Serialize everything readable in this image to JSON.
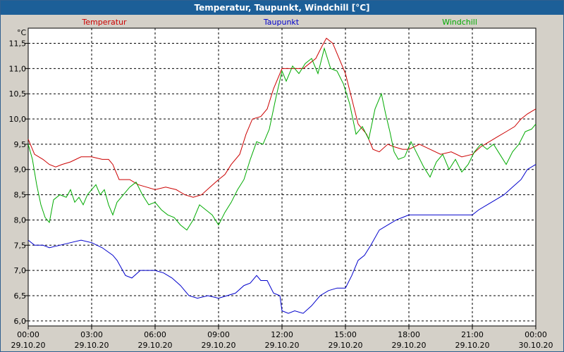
{
  "window": {
    "title": "Temperatur, Taupunkt, Windchill [°C]"
  },
  "chart_data": {
    "type": "line",
    "title": "Temperatur, Taupunkt, Windchill [°C]",
    "ylabel": "°C",
    "xlabel": "",
    "ylim": [
      5.9,
      11.8
    ],
    "xlim": [
      0,
      24
    ],
    "grid": true,
    "legend": "top",
    "y_ticks": [
      "6,0",
      "6,5",
      "7,0",
      "7,5",
      "8,0",
      "8,5",
      "9,0",
      "9,5",
      "10,0",
      "10,5",
      "11,0",
      "11,5"
    ],
    "x_ticks": [
      {
        "time": "00:00",
        "date": "29.10.20"
      },
      {
        "time": "03:00",
        "date": "29.10.20"
      },
      {
        "time": "06:00",
        "date": "29.10.20"
      },
      {
        "time": "09:00",
        "date": "29.10.20"
      },
      {
        "time": "12:00",
        "date": "29.10.20"
      },
      {
        "time": "15:00",
        "date": "29.10.20"
      },
      {
        "time": "18:00",
        "date": "29.10.20"
      },
      {
        "time": "21:00",
        "date": "29.10.20"
      },
      {
        "time": "00:00",
        "date": "30.10.20"
      }
    ],
    "series": [
      {
        "name": "Temperatur",
        "color": "#cc0000",
        "points": [
          [
            0,
            9.6
          ],
          [
            0.3,
            9.3
          ],
          [
            0.7,
            9.2
          ],
          [
            1,
            9.1
          ],
          [
            1.3,
            9.05
          ],
          [
            1.6,
            9.1
          ],
          [
            2,
            9.15
          ],
          [
            2.5,
            9.25
          ],
          [
            3,
            9.25
          ],
          [
            3.5,
            9.2
          ],
          [
            3.8,
            9.2
          ],
          [
            4,
            9.1
          ],
          [
            4.3,
            8.8
          ],
          [
            4.8,
            8.8
          ],
          [
            5.2,
            8.7
          ],
          [
            5.6,
            8.65
          ],
          [
            6,
            8.6
          ],
          [
            6.5,
            8.65
          ],
          [
            7,
            8.6
          ],
          [
            7.4,
            8.5
          ],
          [
            7.8,
            8.45
          ],
          [
            8.2,
            8.5
          ],
          [
            8.6,
            8.65
          ],
          [
            9,
            8.8
          ],
          [
            9.3,
            8.9
          ],
          [
            9.6,
            9.1
          ],
          [
            10,
            9.3
          ],
          [
            10.3,
            9.7
          ],
          [
            10.6,
            10.0
          ],
          [
            11,
            10.05
          ],
          [
            11.3,
            10.2
          ],
          [
            11.6,
            10.6
          ],
          [
            12,
            11.0
          ],
          [
            12.5,
            11.0
          ],
          [
            13,
            11.0
          ],
          [
            13.3,
            11.1
          ],
          [
            13.6,
            11.2
          ],
          [
            13.9,
            11.45
          ],
          [
            14.1,
            11.6
          ],
          [
            14.4,
            11.5
          ],
          [
            14.8,
            11.1
          ],
          [
            15,
            10.9
          ],
          [
            15.3,
            10.4
          ],
          [
            15.6,
            9.9
          ],
          [
            16,
            9.7
          ],
          [
            16.3,
            9.4
          ],
          [
            16.6,
            9.35
          ],
          [
            17,
            9.5
          ],
          [
            17.3,
            9.45
          ],
          [
            17.7,
            9.4
          ],
          [
            18,
            9.4
          ],
          [
            18.5,
            9.5
          ],
          [
            19,
            9.4
          ],
          [
            19.5,
            9.3
          ],
          [
            20,
            9.35
          ],
          [
            20.5,
            9.25
          ],
          [
            21,
            9.3
          ],
          [
            21.4,
            9.45
          ],
          [
            21.8,
            9.55
          ],
          [
            22.2,
            9.65
          ],
          [
            22.6,
            9.75
          ],
          [
            23,
            9.85
          ],
          [
            23.3,
            10.0
          ],
          [
            23.6,
            10.1
          ],
          [
            24,
            10.2
          ]
        ]
      },
      {
        "name": "Taupunkt",
        "color": "#0000cc",
        "points": [
          [
            0,
            7.6
          ],
          [
            0.3,
            7.5
          ],
          [
            0.7,
            7.5
          ],
          [
            1,
            7.45
          ],
          [
            1.5,
            7.5
          ],
          [
            2,
            7.55
          ],
          [
            2.5,
            7.6
          ],
          [
            3,
            7.55
          ],
          [
            3.5,
            7.45
          ],
          [
            4,
            7.3
          ],
          [
            4.2,
            7.2
          ],
          [
            4.6,
            6.9
          ],
          [
            4.9,
            6.85
          ],
          [
            5.3,
            7.0
          ],
          [
            6,
            7.0
          ],
          [
            6.4,
            6.95
          ],
          [
            6.8,
            6.85
          ],
          [
            7.2,
            6.7
          ],
          [
            7.6,
            6.5
          ],
          [
            8,
            6.45
          ],
          [
            8.5,
            6.5
          ],
          [
            9,
            6.45
          ],
          [
            9.4,
            6.5
          ],
          [
            9.8,
            6.55
          ],
          [
            10.2,
            6.7
          ],
          [
            10.5,
            6.75
          ],
          [
            10.8,
            6.9
          ],
          [
            11,
            6.8
          ],
          [
            11.3,
            6.8
          ],
          [
            11.6,
            6.55
          ],
          [
            11.9,
            6.5
          ],
          [
            12,
            6.2
          ],
          [
            12.3,
            6.15
          ],
          [
            12.6,
            6.2
          ],
          [
            13,
            6.15
          ],
          [
            13.4,
            6.3
          ],
          [
            13.8,
            6.5
          ],
          [
            14.2,
            6.6
          ],
          [
            14.6,
            6.65
          ],
          [
            15,
            6.65
          ],
          [
            15.3,
            6.9
          ],
          [
            15.6,
            7.2
          ],
          [
            15.9,
            7.3
          ],
          [
            16.2,
            7.5
          ],
          [
            16.6,
            7.8
          ],
          [
            17,
            7.9
          ],
          [
            17.4,
            8.0
          ],
          [
            17.7,
            8.05
          ],
          [
            18,
            8.1
          ],
          [
            18.5,
            8.1
          ],
          [
            19,
            8.1
          ],
          [
            19.5,
            8.1
          ],
          [
            20,
            8.1
          ],
          [
            20.5,
            8.1
          ],
          [
            21,
            8.1
          ],
          [
            21.3,
            8.2
          ],
          [
            21.7,
            8.3
          ],
          [
            22.1,
            8.4
          ],
          [
            22.5,
            8.5
          ],
          [
            22.9,
            8.65
          ],
          [
            23.3,
            8.8
          ],
          [
            23.6,
            9.0
          ],
          [
            24,
            9.1
          ]
        ]
      },
      {
        "name": "Windchill",
        "color": "#00aa00",
        "points": [
          [
            0,
            9.5
          ],
          [
            0.2,
            9.2
          ],
          [
            0.4,
            8.7
          ],
          [
            0.6,
            8.3
          ],
          [
            0.8,
            8.05
          ],
          [
            1,
            7.95
          ],
          [
            1.2,
            8.4
          ],
          [
            1.5,
            8.5
          ],
          [
            1.8,
            8.45
          ],
          [
            2,
            8.6
          ],
          [
            2.2,
            8.35
          ],
          [
            2.4,
            8.45
          ],
          [
            2.6,
            8.3
          ],
          [
            2.8,
            8.5
          ],
          [
            3,
            8.6
          ],
          [
            3.2,
            8.7
          ],
          [
            3.4,
            8.5
          ],
          [
            3.6,
            8.6
          ],
          [
            3.8,
            8.3
          ],
          [
            4,
            8.1
          ],
          [
            4.2,
            8.35
          ],
          [
            4.5,
            8.5
          ],
          [
            4.8,
            8.65
          ],
          [
            5.1,
            8.75
          ],
          [
            5.4,
            8.5
          ],
          [
            5.7,
            8.3
          ],
          [
            6,
            8.35
          ],
          [
            6.3,
            8.2
          ],
          [
            6.6,
            8.1
          ],
          [
            6.9,
            8.05
          ],
          [
            7.2,
            7.9
          ],
          [
            7.5,
            7.8
          ],
          [
            7.8,
            8.0
          ],
          [
            8.1,
            8.3
          ],
          [
            8.4,
            8.2
          ],
          [
            8.7,
            8.1
          ],
          [
            9,
            7.9
          ],
          [
            9.3,
            8.15
          ],
          [
            9.6,
            8.35
          ],
          [
            9.9,
            8.6
          ],
          [
            10.2,
            8.8
          ],
          [
            10.5,
            9.2
          ],
          [
            10.8,
            9.55
          ],
          [
            11.1,
            9.5
          ],
          [
            11.4,
            9.8
          ],
          [
            11.7,
            10.4
          ],
          [
            12,
            10.95
          ],
          [
            12.2,
            10.75
          ],
          [
            12.5,
            11.05
          ],
          [
            12.8,
            10.9
          ],
          [
            13.1,
            11.1
          ],
          [
            13.4,
            11.2
          ],
          [
            13.7,
            10.9
          ],
          [
            14,
            11.4
          ],
          [
            14.3,
            11.0
          ],
          [
            14.6,
            10.95
          ],
          [
            14.9,
            10.7
          ],
          [
            15.2,
            10.3
          ],
          [
            15.5,
            9.7
          ],
          [
            15.8,
            9.85
          ],
          [
            16.1,
            9.6
          ],
          [
            16.4,
            10.2
          ],
          [
            16.7,
            10.5
          ],
          [
            16.9,
            10.1
          ],
          [
            17.1,
            9.75
          ],
          [
            17.3,
            9.35
          ],
          [
            17.5,
            9.2
          ],
          [
            17.8,
            9.25
          ],
          [
            18.1,
            9.55
          ],
          [
            18.4,
            9.3
          ],
          [
            18.7,
            9.05
          ],
          [
            19,
            8.85
          ],
          [
            19.3,
            9.15
          ],
          [
            19.6,
            9.3
          ],
          [
            19.9,
            9.0
          ],
          [
            20.2,
            9.2
          ],
          [
            20.5,
            8.95
          ],
          [
            20.8,
            9.1
          ],
          [
            21.1,
            9.35
          ],
          [
            21.4,
            9.5
          ],
          [
            21.7,
            9.4
          ],
          [
            22,
            9.5
          ],
          [
            22.3,
            9.3
          ],
          [
            22.6,
            9.1
          ],
          [
            22.9,
            9.35
          ],
          [
            23.2,
            9.5
          ],
          [
            23.5,
            9.75
          ],
          [
            23.8,
            9.8
          ],
          [
            24,
            9.9
          ]
        ]
      }
    ]
  }
}
